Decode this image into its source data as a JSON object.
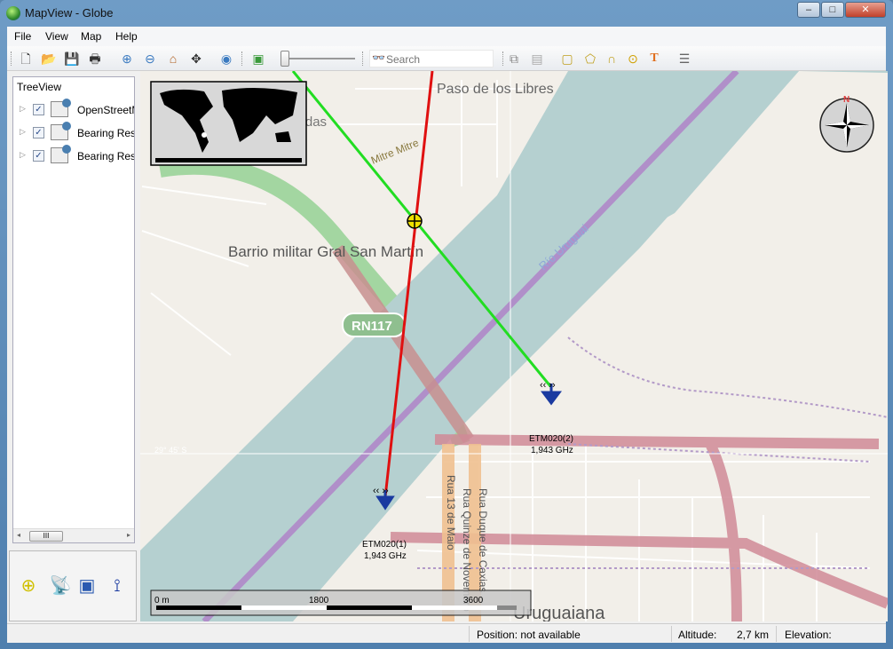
{
  "window": {
    "title": "MapView - Globe",
    "minimize": "–",
    "maximize": "□",
    "close": "✕"
  },
  "menu": [
    "File",
    "View",
    "Map",
    "Help"
  ],
  "toolbar": {
    "search_placeholder": "Search"
  },
  "tree": {
    "header": "TreeView",
    "items": [
      {
        "label": "OpenStreetMap",
        "checked": true
      },
      {
        "label": "Bearing Results",
        "checked": true
      },
      {
        "label": "Bearing Results",
        "checked": true
      }
    ]
  },
  "map": {
    "labels": {
      "barrio": "Barrio militar Gral San Martín",
      "road": "RN117",
      "river": "Río Uruguai",
      "paso": "Paso de los Libres",
      "mitre": "Mitre Mitre",
      "city": "Uruguaiana",
      "lat": "29° 45' S",
      "street1": "Rua Duque de Caxias",
      "street2": "Rua Quinze de Novembro",
      "street3": "Rua 13 de Maio",
      "vendas": "Vendas"
    },
    "stations": [
      {
        "name": "ETM020(1)",
        "freq": "1,943 GHz"
      },
      {
        "name": "ETM020(2)",
        "freq": "1,943 GHz"
      }
    ],
    "compass_n": "N",
    "scale": [
      "0 m",
      "1800",
      "3600"
    ],
    "colors": {
      "bearing1": "#e01010",
      "bearing2": "#22dd22",
      "river": "#b5d0d0",
      "background": "#f2efe9"
    }
  },
  "status": {
    "position": "Position: not available",
    "altitude_label": "Altitude:",
    "altitude": "2,7 km",
    "elevation_label": "Elevation:"
  }
}
